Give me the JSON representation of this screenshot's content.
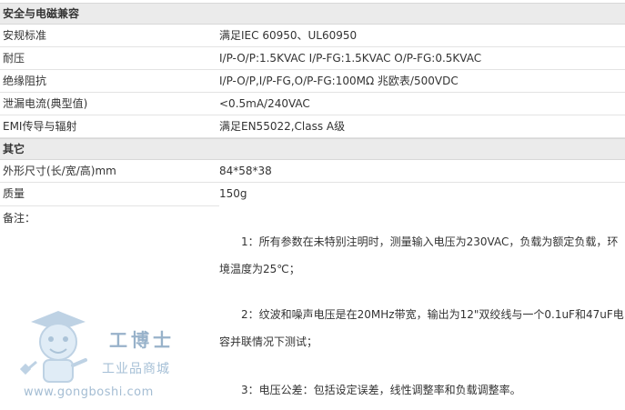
{
  "section_safety": {
    "title": "安全与电磁兼容",
    "rows": [
      {
        "label": "安规标准",
        "value": "满足IEC 60950、UL60950"
      },
      {
        "label": "耐压",
        "value": "I/P-O/P:1.5KVAC I/P-FG:1.5KVAC O/P-FG:0.5KVAC"
      },
      {
        "label": "绝缘阻抗",
        "value": "I/P-O/P,I/P-FG,O/P-FG:100MΩ 兆欧表/500VDC"
      },
      {
        "label": "泄漏电流(典型值)",
        "value": "<0.5mA/240VAC"
      },
      {
        "label": "EMI传导与辐射",
        "value": "满足EN55022,Class A级"
      }
    ]
  },
  "section_other": {
    "title": "其它",
    "rows": [
      {
        "label": "外形尺寸(长/宽/高)mm",
        "value": "84*58*38"
      },
      {
        "label": "质量",
        "value": "150g"
      }
    ]
  },
  "notes": {
    "label": "备注：",
    "items": [
      "1：所有参数在未特别注明时，测量输入电压为230VAC，负载为额定负载，环境温度为25℃；",
      "2：纹波和噪声电压是在20MHz带宽，输出为12\"双绞线与一个0.1uF和47uF电容并联情况下测试；",
      "3：电压公差：包括设定误差，线性调整率和负载调整率。"
    ]
  },
  "watermark": {
    "brand": "工博士",
    "subtitle": "工业品商城",
    "url": "www.gongboshi.com"
  }
}
